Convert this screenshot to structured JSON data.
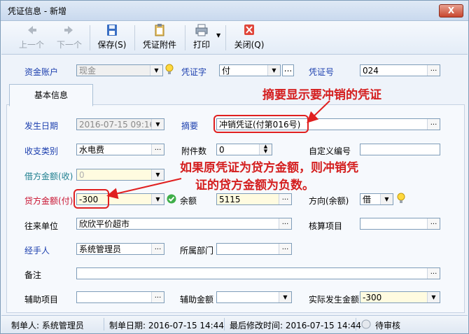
{
  "window": {
    "title": "凭证信息 - 新增",
    "close_label": "X"
  },
  "toolbar": {
    "prev_label": "上一个",
    "next_label": "下一个",
    "save_label": "保存(S)",
    "attachment_label": "凭证附件",
    "print_label": "打印",
    "close_label": "关闭(Q)"
  },
  "header": {
    "account_label": "资金账户",
    "account_value": "现金",
    "voucher_word_label": "凭证字",
    "voucher_word_value": "付",
    "voucher_no_label": "凭证号",
    "voucher_no_value": "024"
  },
  "tabs": [
    {
      "label": "基本信息"
    }
  ],
  "form": {
    "date_label": "发生日期",
    "date_value": "2016-07-15 09:16",
    "summary_label": "摘要",
    "summary_value": "冲销凭证(付第016号)",
    "category_label": "收支类别",
    "category_value": "水电费",
    "attachments_label": "附件数",
    "attachments_value": "0",
    "custom_no_label": "自定义编号",
    "custom_no_value": "",
    "debit_label": "借方金额(收)",
    "debit_value": "0",
    "credit_label": "贷方金额(付)",
    "credit_value": "-300",
    "balance_label": "余额",
    "balance_value": "5115",
    "direction_label": "方向(余额)",
    "direction_value": "借",
    "partner_label": "往来单位",
    "partner_value": "欣欣平价超市",
    "accounting_item_label": "核算项目",
    "accounting_item_value": "",
    "handler_label": "经手人",
    "handler_value": "系统管理员",
    "dept_label": "所属部门",
    "dept_value": "",
    "remark_label": "备注",
    "remark_value": "",
    "aux_item_label": "辅助项目",
    "aux_item_value": "",
    "aux_amount_label": "辅助金额",
    "aux_amount_value": "",
    "actual_amount_label": "实际发生金额",
    "actual_amount_value": "-300"
  },
  "annotations": {
    "summary_note": "摘要显示要冲销的凭证",
    "credit_note_line1": "如果原凭证为贷方金额，则冲销凭",
    "credit_note_line2": "证的贷方金额为负数。"
  },
  "status": {
    "creator": "制单人: 系统管理员",
    "created_date": "制单日期: 2016-07-15 14:44",
    "modified_time": "最后修改时间: 2016-07-15 14:44",
    "state": "待审核"
  },
  "colors": {
    "label_blue": "#1c3fae",
    "label_red": "#c8102e",
    "annotation_red": "#d41e1e"
  },
  "icons": [
    "arrow-left-icon",
    "arrow-right-icon",
    "save-icon",
    "clipboard-icon",
    "printer-icon",
    "close-icon",
    "lightbulb-icon",
    "check-icon"
  ]
}
